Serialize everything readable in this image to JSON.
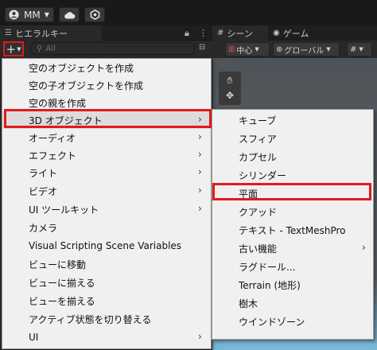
{
  "toolbar": {
    "account_label": "MM",
    "cloud_icon": "cloud-icon",
    "settings_icon": "unity-services-icon"
  },
  "hierarchy": {
    "tab_label": "ヒエラルキー",
    "search_placeholder": "All"
  },
  "scene": {
    "tab_scene": "シーン",
    "tab_game": "ゲーム",
    "pivot_label": "中心",
    "global_label": "グローバル"
  },
  "context_menu": {
    "items": [
      {
        "label": "空のオブジェクトを作成",
        "has_submenu": false
      },
      {
        "label": "空の子オブジェクトを作成",
        "has_submenu": false
      },
      {
        "label": "空の親を作成",
        "has_submenu": false
      },
      {
        "label": "3D オブジェクト",
        "has_submenu": true
      },
      {
        "label": "オーディオ",
        "has_submenu": true
      },
      {
        "label": "エフェクト",
        "has_submenu": true
      },
      {
        "label": "ライト",
        "has_submenu": true
      },
      {
        "label": "ビデオ",
        "has_submenu": true
      },
      {
        "label": "UI ツールキット",
        "has_submenu": true
      },
      {
        "label": "カメラ",
        "has_submenu": false
      },
      {
        "label": "Visual Scripting Scene Variables",
        "has_submenu": false
      },
      {
        "label": "ビューに移動",
        "has_submenu": false
      },
      {
        "label": "ビューに揃える",
        "has_submenu": false
      },
      {
        "label": "ビューを揃える",
        "has_submenu": false
      },
      {
        "label": "アクティブ状態を切り替える",
        "has_submenu": false
      },
      {
        "label": "UI",
        "has_submenu": true
      }
    ],
    "arrow_glyph": "›"
  },
  "submenu_3d": {
    "items": [
      {
        "label": "キューブ",
        "has_submenu": false
      },
      {
        "label": "スフィア",
        "has_submenu": false
      },
      {
        "label": "カプセル",
        "has_submenu": false
      },
      {
        "label": "シリンダー",
        "has_submenu": false
      },
      {
        "label": "平面",
        "has_submenu": false
      },
      {
        "label": "クアッド",
        "has_submenu": false
      },
      {
        "label": "テキスト - TextMeshPro",
        "has_submenu": false
      },
      {
        "label": "古い機能",
        "has_submenu": true
      },
      {
        "label": "ラグドール...",
        "has_submenu": false
      },
      {
        "label": "Terrain (地形)",
        "has_submenu": false
      },
      {
        "label": "樹木",
        "has_submenu": false
      },
      {
        "label": "ウインドゾーン",
        "has_submenu": false
      }
    ]
  },
  "colors": {
    "highlight_red": "#e21a1a",
    "menu_bg": "#f0f0f0",
    "editor_bg": "#282828"
  }
}
